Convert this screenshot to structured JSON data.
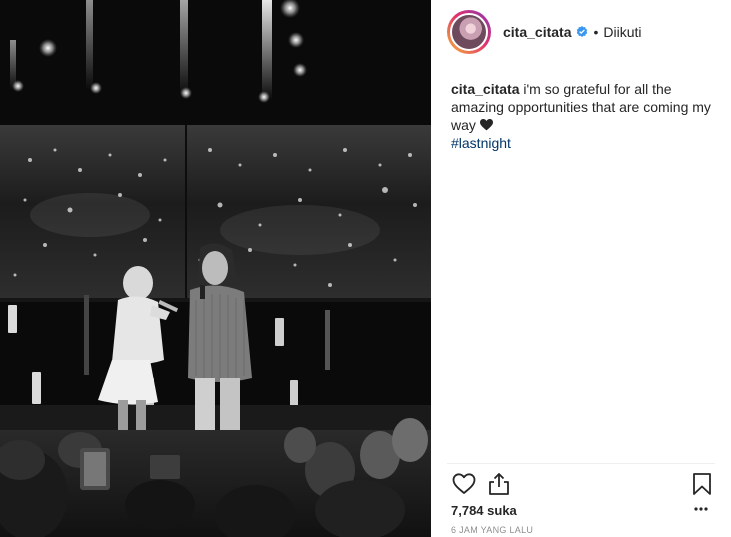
{
  "post": {
    "username": "cita_citata",
    "follow_status": "Diikuti",
    "separator": "•",
    "caption_username": "cita_citata",
    "caption_text": " i'm so grateful for all the amazing opportunities that are coming my way ",
    "hashtag": "#lastnight",
    "likes": "7,784 suka",
    "time_ago": "6 JAM YANG LALU"
  },
  "icons": {
    "verified": "verified-badge-icon",
    "heart": "heart-icon",
    "share": "share-icon",
    "bookmark": "bookmark-icon",
    "more": "more-options-icon",
    "caption_emoji": "black-heart-icon"
  },
  "colors": {
    "verified_blue": "#3897f0",
    "hashtag_link": "#003569",
    "timestamp_gray": "#8e8e8e",
    "divider": "#efefef"
  },
  "image": {
    "description_kind": "black-and-white concert photo"
  }
}
